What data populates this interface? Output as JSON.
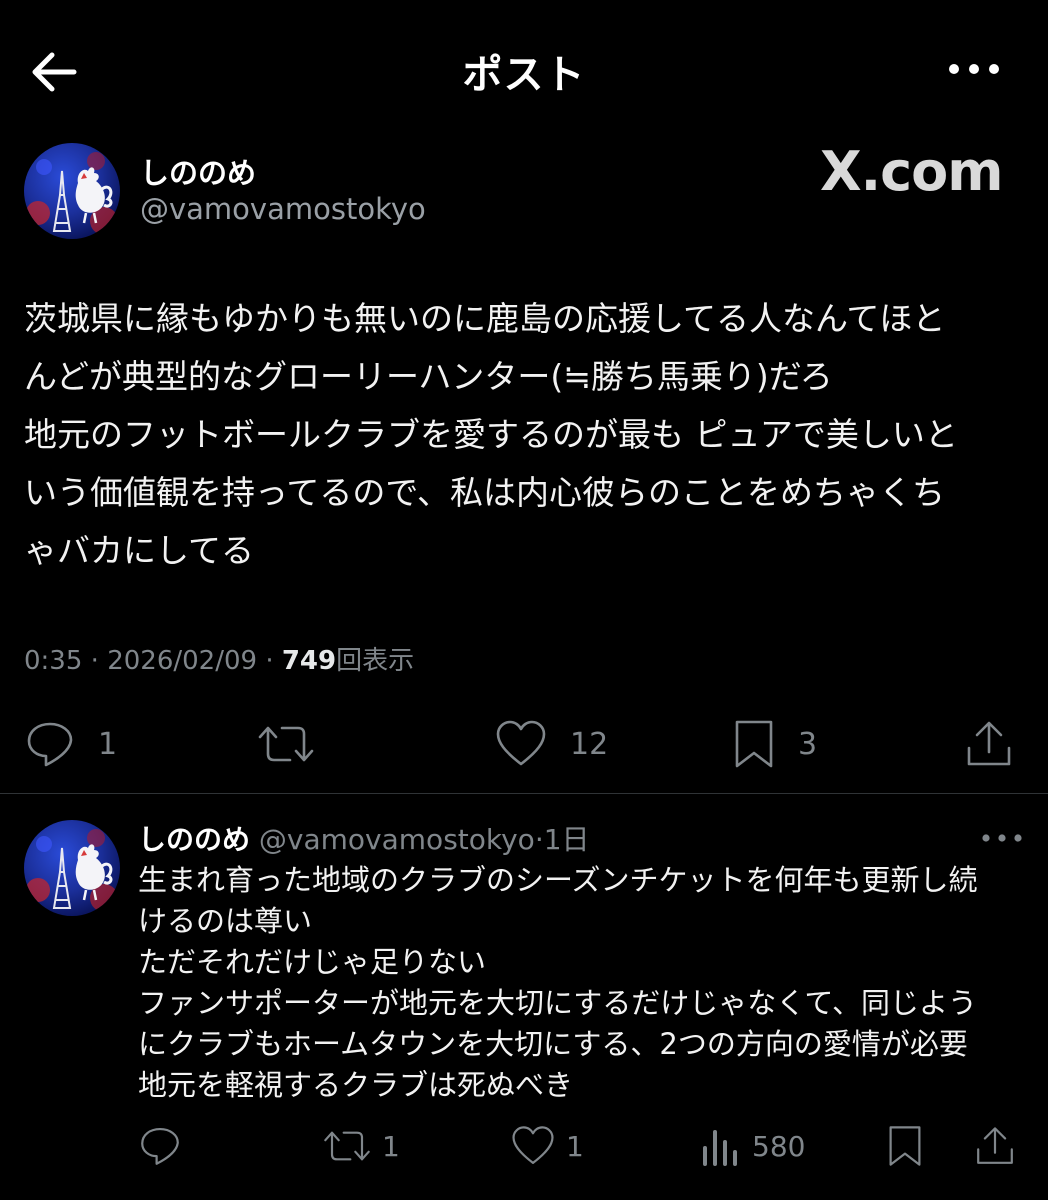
{
  "header": {
    "title": "ポスト"
  },
  "post": {
    "author_name": "しののめ",
    "author_handle": "@vamovamostokyo",
    "watermark": "X.com",
    "body_lines": [
      "茨城県に縁もゆかりも無いのに鹿島の応援してる人なんてほと",
      "んどが典型的なグローリーハンター(≒勝ち馬乗り)だろ",
      "地元のフットボールクラブを愛するのが最も ピュアで美しいと",
      "いう価値観を持ってるので、私は内心彼らのことをめちゃくち",
      "ゃバカにしてる"
    ],
    "time": "0:35",
    "date": "2026/02/09",
    "separator": "·",
    "views_count": "749",
    "views_label": "回表示",
    "stats": {
      "replies": "1",
      "reposts": "",
      "likes": "12",
      "bookmarks": "3"
    }
  },
  "reply": {
    "author_name": "しののめ",
    "author_handle": "@vamovamostokyo",
    "separator": "·",
    "age": "1日",
    "body_lines": [
      "生まれ育った地域のクラブのシーズンチケットを何年も更新し続",
      "けるのは尊い",
      "ただそれだけじゃ足りない",
      "ファンサポーターが地元を大切にするだけじゃなくて、同じよう",
      "にクラブもホームタウンを大切にする、2つの方向の愛情が必要",
      "地元を軽視するクラブは死ぬべき"
    ],
    "stats": {
      "replies": "",
      "reposts": "1",
      "likes": "1",
      "views": "580"
    }
  },
  "icons": {
    "back": "arrow-left-icon",
    "more": "more-dots-icon",
    "reply": "speech-bubble-icon",
    "repost": "repost-arrows-icon",
    "like": "heart-icon",
    "bookmark": "bookmark-icon",
    "share": "share-upload-icon",
    "views": "bar-chart-icon"
  },
  "colors": {
    "background": "#000000",
    "text": "#e7e9ea",
    "muted": "#80868b",
    "divider": "#2f3336"
  }
}
